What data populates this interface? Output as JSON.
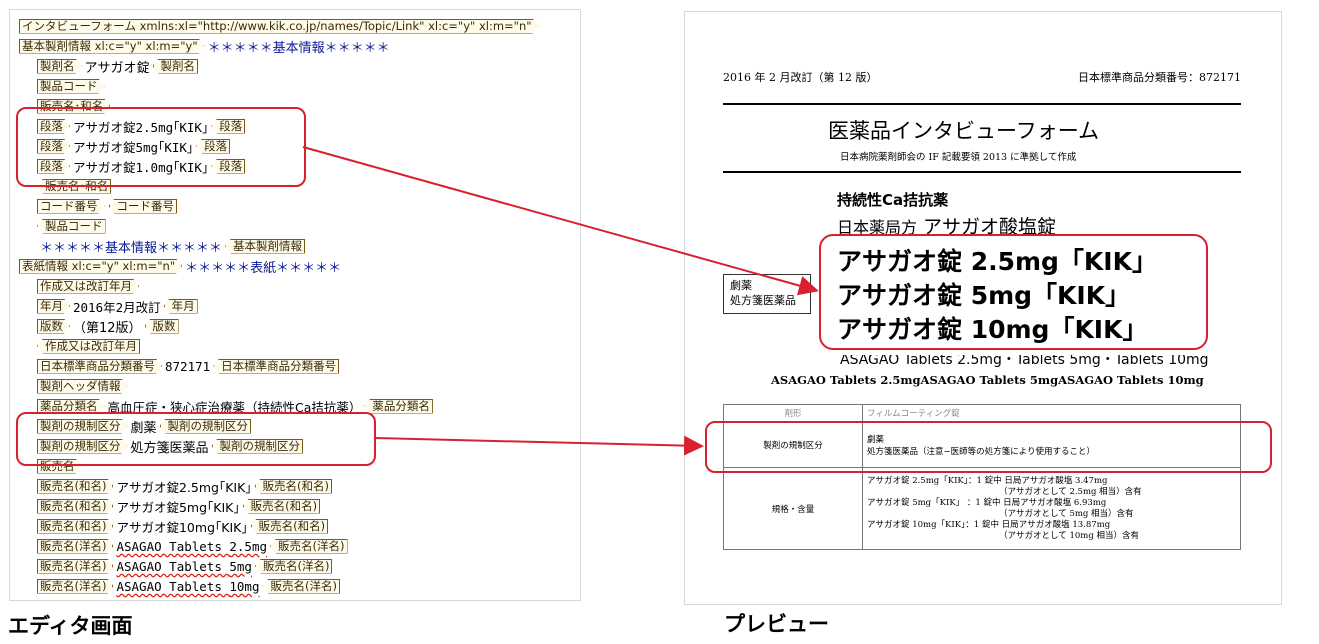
{
  "editor": {
    "root_tag": "インタビューフォーム xmlns:xl=\"http://www.kik.co.jp/names/Topic/Link\" xl:c=\"y\" xl:m=\"n\"",
    "basic_tag": "基本製剤情報 xl:c=\"y\" xl:m=\"y\"",
    "basic_text": "＊＊＊＊＊基本情報＊＊＊＊＊",
    "basic_close_tag": "基本製剤情報",
    "product_name_tag": "製剤名",
    "product_name": "アサガオ錠",
    "product_code_tag": "製品コード",
    "sales_name_jp_tag": "販売名･和名",
    "paragraph_tag": "段落",
    "paragraphs": [
      "アサガオ錠2.5mg｢KIK｣",
      "アサガオ錠5mg｢KIK｣",
      "アサガオ錠1.0mg｢KIK｣"
    ],
    "code_number_tag": "コード番号",
    "cover_tag": "表紙情報 xl:c=\"y\" xl:m=\"n\"",
    "cover_text": "＊＊＊＊＊表紙＊＊＊＊＊",
    "revision_tag": "作成又は改訂年月",
    "year_month_tag": "年月",
    "year_month": "2016年2月改訂",
    "edition_tag": "版数",
    "edition": "（第12版）",
    "jsc_tag": "日本標準商品分類番号",
    "jsc_number": "872171",
    "header_tag": "製剤ヘッダ情報",
    "category_tag": "薬品分類名",
    "category": "高血圧症・狭心症治療薬（持続性Ca拮抗薬）",
    "regulation_tag": "製剤の規制区分",
    "regulations": [
      "劇薬",
      "処方箋医薬品"
    ],
    "sales_name_tag": "販売名",
    "sales_name_jp_item_tag": "販売名(和名)",
    "sales_names_jp": [
      "アサガオ錠2.5mg｢KIK｣",
      "アサガオ錠5mg｢KIK｣",
      "アサガオ錠10mg｢KIK｣"
    ],
    "sales_name_en_tag": "販売名(洋名)",
    "sales_names_en": [
      {
        "base": "ASAGAO Tablets ",
        "dose": "2.5mg"
      },
      {
        "base": "ASAGAO Tablets ",
        "dose": "5mg"
      },
      {
        "base": "ASAGAO Tablets ",
        "dose": "10mg"
      }
    ]
  },
  "preview": {
    "revision": "2016 年 2 月改訂（第 12 版）",
    "jsc": "日本標準商品分類番号：872171",
    "title": "医薬品インタビューフォーム",
    "subtitle": "日本病院薬剤師会の IF 記載要領 2013 に準拠して作成",
    "category": "持続性Ca拮抗薬",
    "pharmacopoeia": "日本薬局方",
    "generic_name": "アサガオ酸塩錠",
    "regulation_box": [
      "劇薬",
      "処方箋医薬品"
    ],
    "brand_names": [
      "アサガオ錠 2.5mg「KIK」",
      "アサガオ錠 5mg「KIK」",
      "アサガオ錠 10mg「KIK」"
    ],
    "english_names": "ASAGAO Tablets 2.5mg・Tablets 5mg・Tablets 10mg",
    "english_names_raw": "ASAGAO Tablets 2.5mgASAGAO Tablets 5mgASAGAO Tablets 10mg",
    "table": {
      "form_label": "剤形",
      "form_value": "フィルムコーティング錠",
      "regulation_label": "製剤の規制区分",
      "regulation_values": [
        "劇薬",
        "処方箋医薬品（注意−医師等の処方箋により使用すること）"
      ],
      "strength_label": "規格・含量",
      "strength_values": [
        "アサガオ錠 2.5mg「KIK」：1 錠中 日局アサガオ酸塩 3.47mg",
        "（アサガオとして 2.5mg 相当）含有",
        "アサガオ錠 5mg「KIK」 ：1 錠中 日局アサガオ酸塩 6.93mg",
        "（アサガオとして 5mg 相当）含有",
        "アサガオ錠 10mg「KIK」：1 錠中 日局アサガオ酸塩 13.87mg",
        "（アサガオとして 10mg 相当）含有"
      ]
    }
  },
  "captions": {
    "editor": "エディタ画面",
    "preview": "プレビュー"
  },
  "colors": {
    "highlight": "#d9202e",
    "tag_border": "#7a5a14",
    "blue_text": "#0a1a96"
  }
}
